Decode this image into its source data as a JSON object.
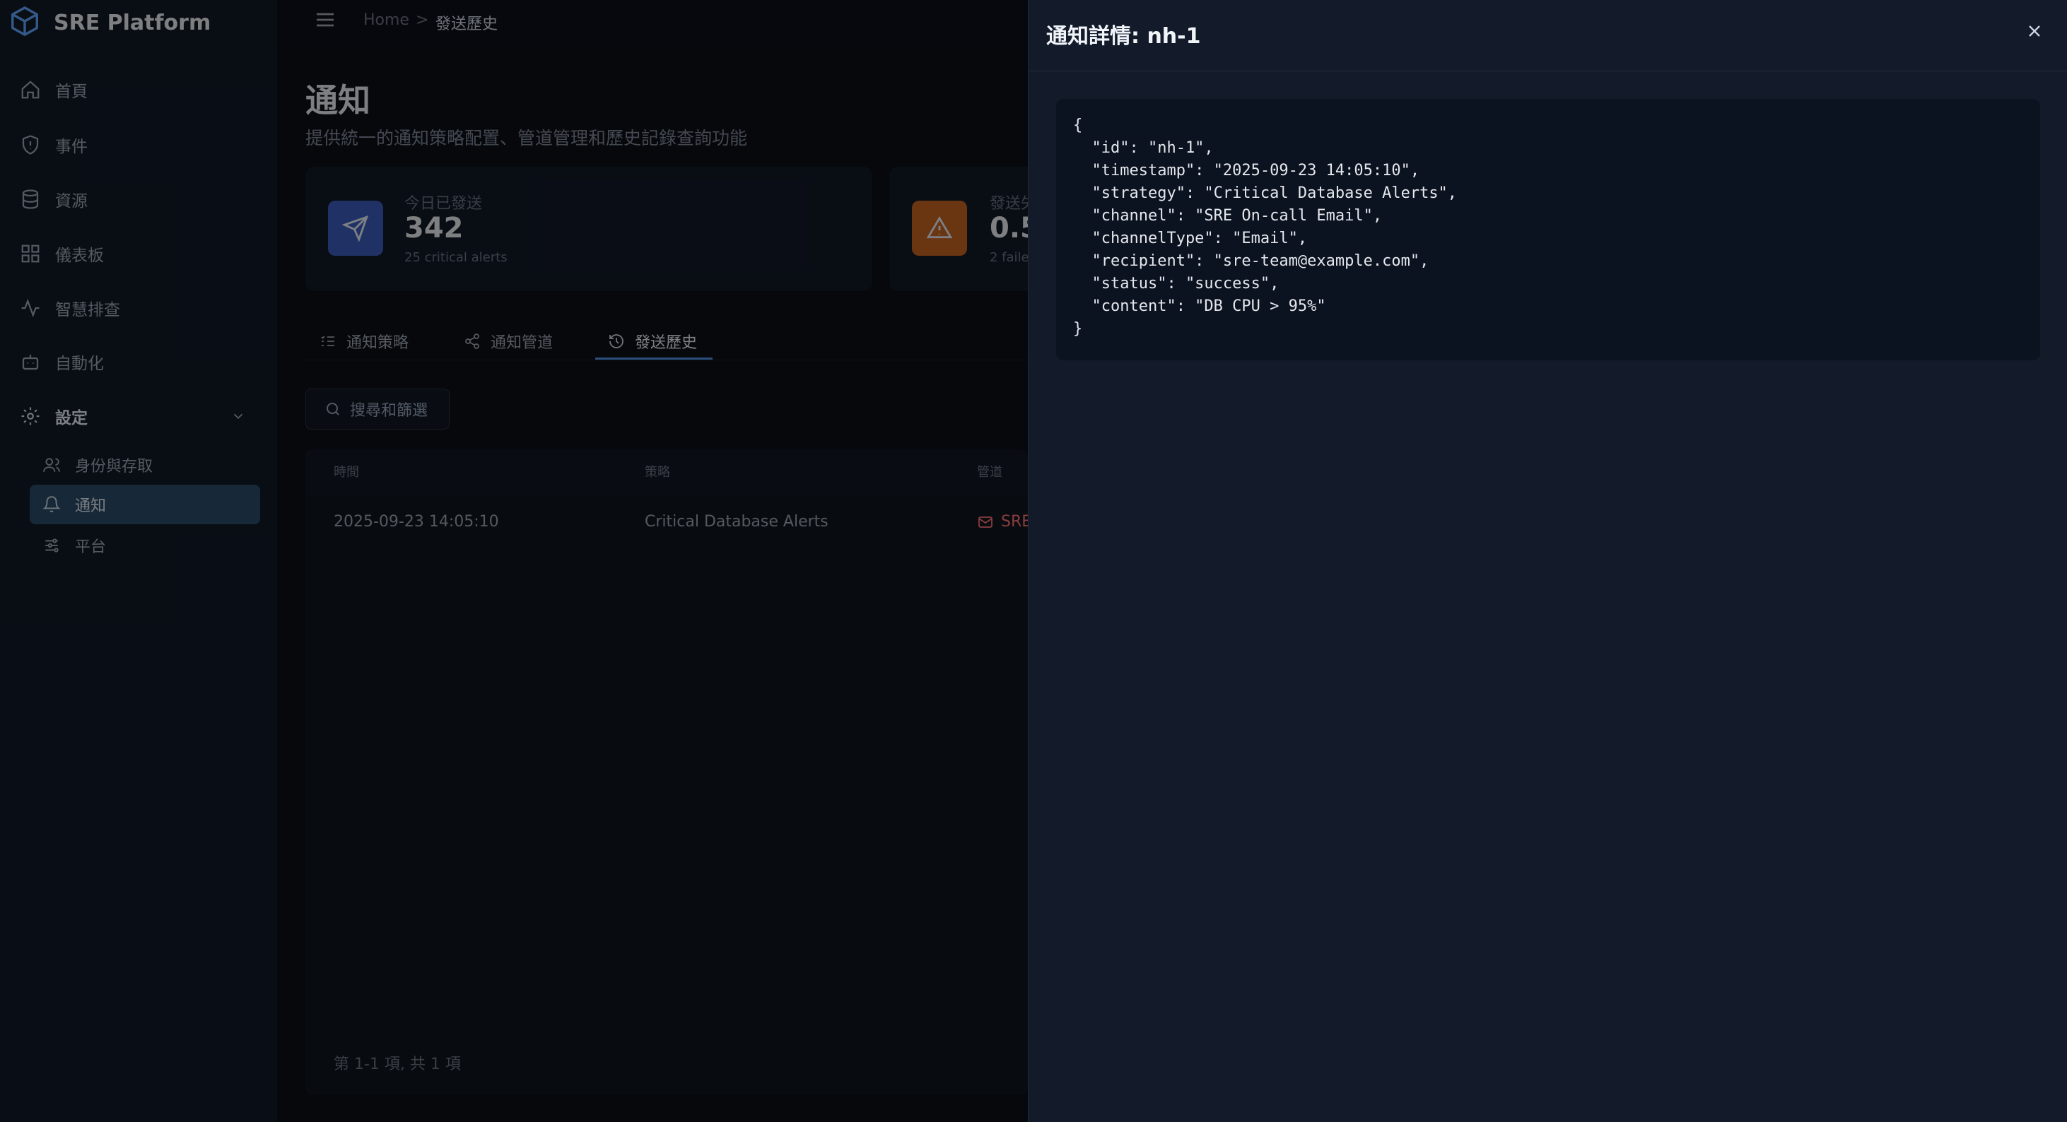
{
  "app": {
    "title": "SRE Platform"
  },
  "sidebar": {
    "items": [
      {
        "label": "首頁",
        "icon": "home-icon"
      },
      {
        "label": "事件",
        "icon": "shield-icon"
      },
      {
        "label": "資源",
        "icon": "database-icon"
      },
      {
        "label": "儀表板",
        "icon": "dashboard-icon"
      },
      {
        "label": "智慧排查",
        "icon": "activity-icon"
      },
      {
        "label": "自動化",
        "icon": "bot-icon"
      },
      {
        "label": "設定",
        "icon": "gear-icon"
      }
    ],
    "sub_items": [
      {
        "label": "身份與存取",
        "icon": "users-icon"
      },
      {
        "label": "通知",
        "icon": "bell-icon",
        "active": true
      },
      {
        "label": "平台",
        "icon": "sliders-icon"
      }
    ]
  },
  "breadcrumb": {
    "home": "Home",
    "separator": ">",
    "current": "發送歷史"
  },
  "page": {
    "title": "通知",
    "subtitle": "提供統一的通知策略配置、管道管理和歷史記錄查詢功能"
  },
  "cards": [
    {
      "label": "今日已發送",
      "value": "342",
      "note": "25 critical alerts",
      "color": "#3b5cb8"
    },
    {
      "label": "發送失",
      "value": "0.5",
      "note": "2 faile",
      "color": "#c2611f"
    }
  ],
  "tabs": [
    {
      "label": "通知策略",
      "icon": "list-check-icon"
    },
    {
      "label": "通知管道",
      "icon": "share-icon"
    },
    {
      "label": "發送歷史",
      "icon": "history-icon",
      "active": true
    }
  ],
  "search": {
    "label": "搜尋和篩選"
  },
  "table": {
    "headers": [
      "時間",
      "策略",
      "管道"
    ],
    "rows": [
      {
        "time": "2025-09-23 14:05:10",
        "strategy": "Critical Database Alerts",
        "channel": "SRE"
      }
    ],
    "pager": "第 1-1 項, 共 1 項"
  },
  "drawer": {
    "title": "通知詳情: nh-1",
    "json": "{\n  \"id\": \"nh-1\",\n  \"timestamp\": \"2025-09-23 14:05:10\",\n  \"strategy\": \"Critical Database Alerts\",\n  \"channel\": \"SRE On-call Email\",\n  \"channelType\": \"Email\",\n  \"recipient\": \"sre-team@example.com\",\n  \"status\": \"success\",\n  \"content\": \"DB CPU > 95%\"\n}"
  }
}
